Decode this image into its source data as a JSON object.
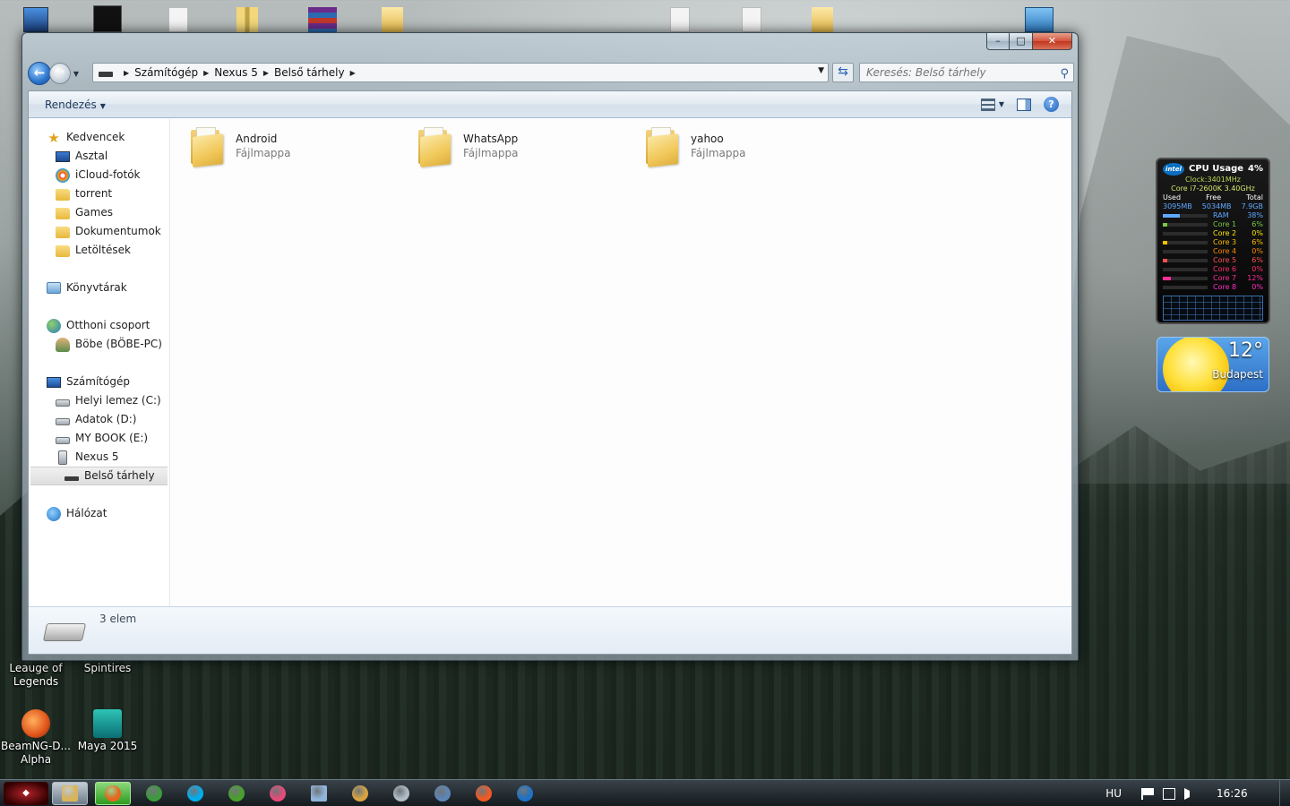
{
  "desktop": {
    "icons": [
      {
        "label": "Leauge of Legends"
      },
      {
        "label": "Spintires"
      },
      {
        "label": "BeamNG-D... Alpha"
      },
      {
        "label": "Maya 2015"
      }
    ]
  },
  "window": {
    "caption": {
      "minimize": "–",
      "maximize": "□",
      "close": "✕"
    },
    "breadcrumbs": [
      "Számítógép",
      "Nexus 5",
      "Belső tárhely"
    ],
    "search": {
      "placeholder": "Keresés: Belső tárhely"
    },
    "toolbar": {
      "organize_label": "Rendezés"
    },
    "nav_tree": [
      {
        "label": "Kedvencek",
        "icon": "star-icon",
        "level": 0
      },
      {
        "label": "Asztal",
        "icon": "desktop-icon",
        "level": 1
      },
      {
        "label": "iCloud-fotók",
        "icon": "icloud-icon",
        "level": 1
      },
      {
        "label": "torrent",
        "icon": "folder-icon",
        "level": 1
      },
      {
        "label": "Games",
        "icon": "folder-icon",
        "level": 1
      },
      {
        "label": "Dokumentumok",
        "icon": "folder-icon",
        "level": 1
      },
      {
        "label": "Letöltések",
        "icon": "folder-icon",
        "level": 1
      },
      {
        "label": "Könyvtárak",
        "icon": "library-icon",
        "level": 0
      },
      {
        "label": "Otthoni csoport",
        "icon": "homegroup-icon",
        "level": 0
      },
      {
        "label": "Böbe (BÖBE-PC)",
        "icon": "user-icon",
        "level": 1
      },
      {
        "label": "Számítógép",
        "icon": "computer-icon",
        "level": 0
      },
      {
        "label": "Helyi lemez (C:)",
        "icon": "hdd-icon",
        "level": 1
      },
      {
        "label": "Adatok (D:)",
        "icon": "hdd-icon",
        "level": 1
      },
      {
        "label": "MY BOOK (E:)",
        "icon": "hdd-icon",
        "level": 1
      },
      {
        "label": "Nexus 5",
        "icon": "phone-icon",
        "level": 1
      },
      {
        "label": "Belső tárhely",
        "icon": "drive-icon",
        "level": 2
      },
      {
        "label": "Hálózat",
        "icon": "network-icon",
        "level": 0
      }
    ],
    "items": [
      {
        "name": "Android",
        "type": "Fájlmappa"
      },
      {
        "name": "WhatsApp",
        "type": "Fájlmappa"
      },
      {
        "name": "yahoo",
        "type": "Fájlmappa"
      }
    ],
    "details": {
      "count": "3 elem"
    }
  },
  "gadgets": {
    "cpu": {
      "brand": "intel",
      "title": "CPU Usage",
      "usage": "4%",
      "clock": "Clock:3401MHz",
      "model": "Core i7-2600K 3.40GHz",
      "mem_headers": [
        "Used",
        "Free",
        "Total"
      ],
      "mem_values": [
        "3095MB",
        "5034MB",
        "7.9GB"
      ],
      "ram_label": "RAM",
      "ram_pct": "38%",
      "cores": [
        {
          "name": "Core 1",
          "pct": "6%",
          "color": "#7ac943"
        },
        {
          "name": "Core 2",
          "pct": "0%",
          "color": "#ffe600"
        },
        {
          "name": "Core 3",
          "pct": "6%",
          "color": "#ffbf00"
        },
        {
          "name": "Core 4",
          "pct": "0%",
          "color": "#ff8a00"
        },
        {
          "name": "Core 5",
          "pct": "6%",
          "color": "#ff4f4f"
        },
        {
          "name": "Core 6",
          "pct": "0%",
          "color": "#ff2d6a"
        },
        {
          "name": "Core 7",
          "pct": "12%",
          "color": "#ff2d9b"
        },
        {
          "name": "Core 8",
          "pct": "0%",
          "color": "#ff2dc8"
        }
      ]
    },
    "weather": {
      "temp": "12°",
      "city": "Budapest"
    }
  },
  "taskbar": {
    "tray_lang": "HU",
    "clock": "16:26",
    "apps": [
      {
        "name": "explorer",
        "color": "#d8b45a"
      },
      {
        "name": "firefox",
        "color": "#e8661e"
      },
      {
        "name": "chrome",
        "color": "#3c9b3c"
      },
      {
        "name": "skype",
        "color": "#00aff0"
      },
      {
        "name": "utorrent",
        "color": "#48a12b"
      },
      {
        "name": "itunes",
        "color": "#e84a7a"
      },
      {
        "name": "notepad",
        "color": "#8fb3d9"
      },
      {
        "name": "paint",
        "color": "#d9a441"
      },
      {
        "name": "media",
        "color": "#b0bcc6"
      },
      {
        "name": "steam",
        "color": "#5d86b8"
      },
      {
        "name": "origin",
        "color": "#f15a24"
      },
      {
        "name": "outlook",
        "color": "#1e72c6"
      }
    ]
  }
}
